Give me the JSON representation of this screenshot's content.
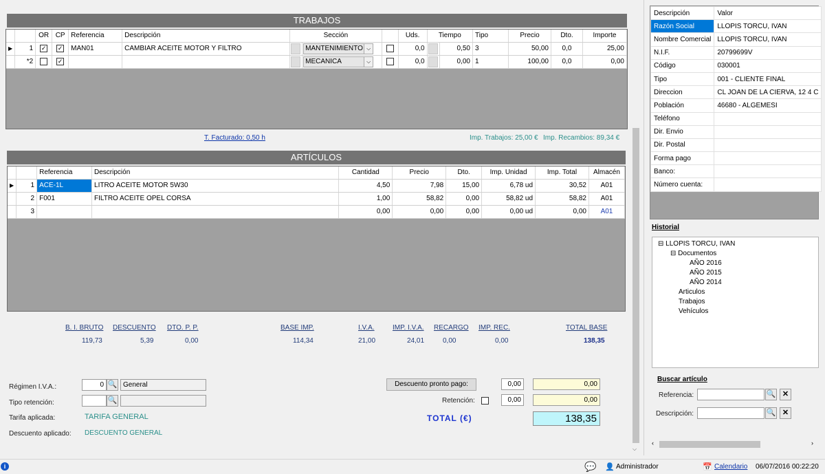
{
  "trabajos": {
    "title": "TRABAJOS",
    "columns": [
      "OR",
      "CP",
      "Referencia",
      "Descripción",
      "Sección",
      "Uds.",
      "Tiempo",
      "Tipo",
      "Precio",
      "Dto.",
      "Importe"
    ],
    "rows": [
      {
        "num": "1",
        "or": "✓",
        "cp": "✓",
        "ref": "MAN01",
        "desc": "CAMBIAR ACEITE MOTOR Y FILTRO",
        "seccion": "MANTENIMIENTO",
        "uds": "0,0",
        "tiempo": "0,50",
        "tipo": "3",
        "precio": "50,00",
        "dto": "0,0",
        "importe": "25,00"
      },
      {
        "num": "*2",
        "or": "",
        "cp": "✓",
        "ref": "",
        "desc": "",
        "seccion": "MECANICA",
        "uds": "0,0",
        "tiempo": "0,00",
        "tipo": "1",
        "precio": "100,00",
        "dto": "0,0",
        "importe": "0,00"
      }
    ],
    "facturado": "T. Facturado: 0,50 h",
    "imp_trabajos": "Imp. Trabajos: 25,00 €",
    "imp_recambios": "Imp. Recambios: 89,34 €"
  },
  "articulos": {
    "title": "ARTÍCULOS",
    "columns": [
      "Referencia",
      "Descripción",
      "Cantidad",
      "Precio",
      "Dto.",
      "Imp. Unidad",
      "Imp. Total",
      "Almacén"
    ],
    "rows": [
      {
        "num": "1",
        "ref": "ACE-1L",
        "desc": "LITRO ACEITE MOTOR 5W30",
        "cantidad": "4,50",
        "precio": "7,98",
        "dto": "15,00",
        "unidad": "6,78 ud",
        "total": "30,52",
        "almacen": "A01"
      },
      {
        "num": "2",
        "ref": "F001",
        "desc": "FILTRO ACEITE OPEL CORSA",
        "cantidad": "1,00",
        "precio": "58,82",
        "dto": "0,00",
        "unidad": "58,82 ud",
        "total": "58,82",
        "almacen": "A01"
      },
      {
        "num": "3",
        "ref": "",
        "desc": "",
        "cantidad": "0,00",
        "precio": "0,00",
        "dto": "0,00",
        "unidad": "0,00 ud",
        "total": "0,00",
        "almacen": "A01"
      }
    ]
  },
  "totales": {
    "bi_bruto_label": "B. I. BRUTO",
    "bi_bruto": "119,73",
    "descuento_label": "DESCUENTO",
    "descuento": "5,39",
    "dtopp_label": "DTO. P. P.",
    "dtopp": "0,00",
    "base_label": "BASE IMP.",
    "base": "114,34",
    "iva_label": "I.V.A.",
    "iva": "21,00",
    "imp_iva_label": "IMP. I.V.A.",
    "imp_iva": "24,01",
    "recargo_label": "RECARGO",
    "recargo": "0,00",
    "imp_rec_label": "IMP. REC.",
    "imp_rec": "0,00",
    "total_base_label": "TOTAL BASE",
    "total_base": "138,35"
  },
  "form": {
    "regimen_label": "Régimen I.V.A.:",
    "regimen_code": "0",
    "regimen_name": "General",
    "retencion_tipo_label": "Tipo retención:",
    "tarifa_label": "Tarifa aplicada:",
    "tarifa": "TARIFA GENERAL",
    "descuento_label": "Descuento aplicado:",
    "descuento": "DESCUENTO GENERAL",
    "pronto_pago_button": "Descuento pronto pago:",
    "pronto_pago_pct": "0,00",
    "pronto_pago_val": "0,00",
    "retencion_label": "Retención:",
    "retencion_pct": "0,00",
    "retencion_val": "0,00",
    "total_label": "TOTAL (€)",
    "total": "138,35"
  },
  "client": {
    "header_desc": "Descripción",
    "header_val": "Valor",
    "rows": [
      {
        "k": "Razón Social",
        "v": "LLOPIS TORCU, IVAN"
      },
      {
        "k": "Nombre Comercial",
        "v": "LLOPIS TORCU, IVAN"
      },
      {
        "k": "N.I.F.",
        "v": "20799699V"
      },
      {
        "k": "Código",
        "v": "030001"
      },
      {
        "k": "Tipo",
        "v": "001 - CLIENTE FINAL"
      },
      {
        "k": "Direccion",
        "v": "CL JOAN DE LA CIERVA, 12 4 C"
      },
      {
        "k": "Población",
        "v": "46680 - ALGEMESI"
      },
      {
        "k": "Teléfono",
        "v": ""
      },
      {
        "k": "Dir. Envio",
        "v": ""
      },
      {
        "k": "Dir. Postal",
        "v": ""
      },
      {
        "k": "Forma pago",
        "v": ""
      },
      {
        "k": "Banco:",
        "v": ""
      },
      {
        "k": "Número cuenta:",
        "v": ""
      }
    ]
  },
  "historial": {
    "title": "Historial",
    "root": "LLOPIS TORCU, IVAN",
    "documentos": "Documentos",
    "years": [
      "AÑO 2016",
      "AÑO 2015",
      "AÑO 2014"
    ],
    "articulos": "Articulos",
    "trabajos": "Trabajos",
    "vehiculos": "Vehículos"
  },
  "buscar": {
    "title": "Buscar artículo",
    "referencia_label": "Referencia:",
    "descripcion_label": "Descripción:"
  },
  "status": {
    "user": "Administrador",
    "calendario": "Calendario",
    "datetime": "06/07/2016 00:22:20"
  },
  "colors": {
    "accent": "#0078d7",
    "section": "#737373",
    "total_bg": "#bff5fb",
    "yellow_bg": "#fdfbd8",
    "teal": "#2a8f8a"
  }
}
